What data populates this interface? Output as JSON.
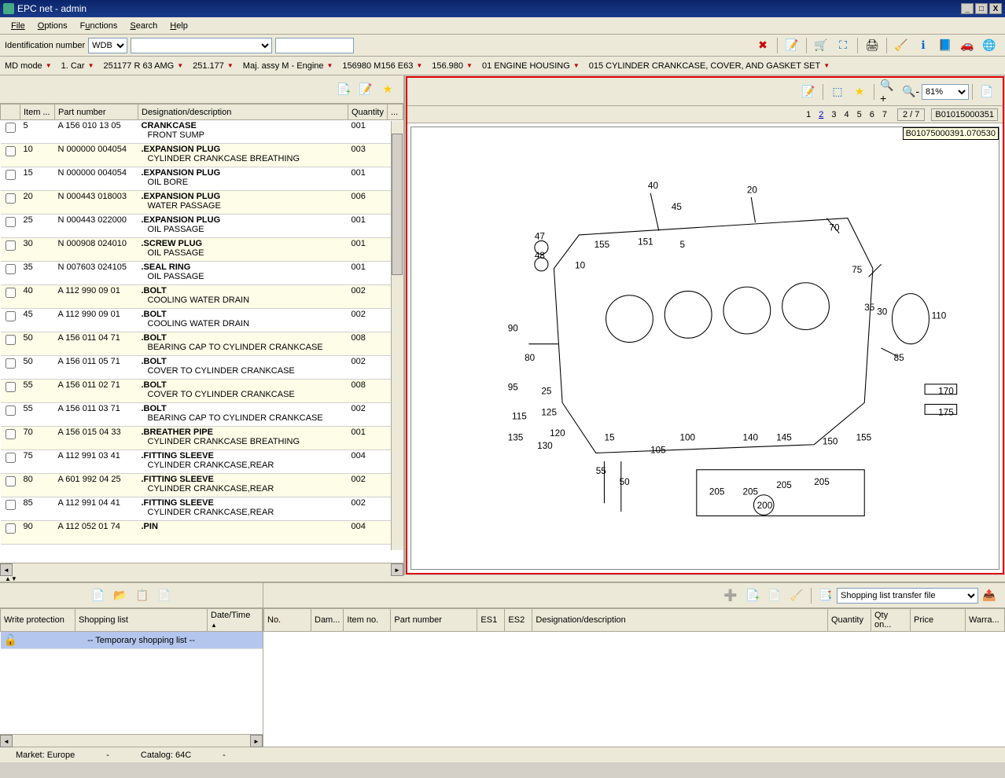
{
  "window": {
    "title": "EPC net - admin",
    "min": "_",
    "max": "□",
    "close": "X"
  },
  "menu": {
    "file": "File",
    "options": "Options",
    "functions": "Functions",
    "search": "Search",
    "help": "Help"
  },
  "idbar": {
    "label": "Identification number",
    "type_value": "WDB"
  },
  "breadcrumbs": [
    {
      "label": "MD mode"
    },
    {
      "label": "1. Car"
    },
    {
      "label": "251177 R 63 AMG"
    },
    {
      "label": "251.177"
    },
    {
      "label": "Maj. assy M  - Engine"
    },
    {
      "label": "156980 M156 E63"
    },
    {
      "label": "156.980"
    },
    {
      "label": "01 ENGINE HOUSING"
    },
    {
      "label": "015 CYLINDER CRANKCASE, COVER, AND GASKET SET"
    }
  ],
  "parts_table": {
    "headers": {
      "check": "",
      "item": "Item ...",
      "part": "Part number",
      "desig": "Designation/description",
      "qty": "Quantity",
      "more": "..."
    },
    "rows": [
      {
        "item": "5",
        "part": "A 156 010 13 05",
        "main": "CRANKCASE",
        "sub": "FRONT SUMP",
        "qty": "001"
      },
      {
        "item": "10",
        "part": "N 000000 004054",
        "main": ".EXPANSION PLUG",
        "sub": "CYLINDER CRANKCASE BREATHING",
        "qty": "003"
      },
      {
        "item": "15",
        "part": "N 000000 004054",
        "main": ".EXPANSION PLUG",
        "sub": "OIL BORE",
        "qty": "001"
      },
      {
        "item": "20",
        "part": "N 000443 018003",
        "main": ".EXPANSION PLUG",
        "sub": "WATER PASSAGE",
        "qty": "006"
      },
      {
        "item": "25",
        "part": "N 000443 022000",
        "main": ".EXPANSION PLUG",
        "sub": "OIL PASSAGE",
        "qty": "001"
      },
      {
        "item": "30",
        "part": "N 000908 024010",
        "main": ".SCREW PLUG",
        "sub": "OIL PASSAGE",
        "qty": "001"
      },
      {
        "item": "35",
        "part": "N 007603 024105",
        "main": ".SEAL RING",
        "sub": "OIL PASSAGE",
        "qty": "001"
      },
      {
        "item": "40",
        "part": "A 112 990 09 01",
        "main": ".BOLT",
        "sub": "COOLING WATER DRAIN",
        "qty": "002"
      },
      {
        "item": "45",
        "part": "A 112 990 09 01",
        "main": ".BOLT",
        "sub": "COOLING WATER DRAIN",
        "qty": "002"
      },
      {
        "item": "50",
        "part": "A 156 011 04 71",
        "main": ".BOLT",
        "sub": "BEARING CAP TO CYLINDER CRANKCASE",
        "qty": "008"
      },
      {
        "item": "50",
        "part": "A 156 011 05 71",
        "main": ".BOLT",
        "sub": "COVER TO CYLINDER CRANKCASE",
        "qty": "002"
      },
      {
        "item": "55",
        "part": "A 156 011 02 71",
        "main": ".BOLT",
        "sub": "COVER TO CYLINDER CRANKCASE",
        "qty": "008"
      },
      {
        "item": "55",
        "part": "A 156 011 03 71",
        "main": ".BOLT",
        "sub": "BEARING CAP TO CYLINDER CRANKCASE",
        "qty": "002"
      },
      {
        "item": "70",
        "part": "A 156 015 04 33",
        "main": ".BREATHER PIPE",
        "sub": "CYLINDER CRANKCASE BREATHING",
        "qty": "001"
      },
      {
        "item": "75",
        "part": "A 112 991 03 41",
        "main": ".FITTING SLEEVE",
        "sub": "CYLINDER CRANKCASE,REAR",
        "qty": "004"
      },
      {
        "item": "80",
        "part": "A 601 992 04 25",
        "main": ".FITTING SLEEVE",
        "sub": "CYLINDER CRANKCASE,REAR",
        "qty": "002"
      },
      {
        "item": "85",
        "part": "A 112 991 04 41",
        "main": ".FITTING SLEEVE",
        "sub": "CYLINDER CRANKCASE,REAR",
        "qty": "002"
      },
      {
        "item": "90",
        "part": "A 112 052 01 74",
        "main": ".PIN",
        "sub": "",
        "qty": "004"
      }
    ]
  },
  "diagram": {
    "zoom": "81%",
    "pages": [
      "1",
      "2",
      "3",
      "4",
      "5",
      "6",
      "7"
    ],
    "active_page": "2",
    "page_count": "2 / 7",
    "doc_id": "B01015000351",
    "tooltip": "B01075000391.070530",
    "callouts": [
      "40",
      "20",
      "47",
      "45",
      "48",
      "155",
      "151",
      "5",
      "70",
      "10",
      "75",
      "35",
      "30",
      "90",
      "110",
      "80",
      "85",
      "95",
      "25",
      "170",
      "115",
      "125",
      "175",
      "135",
      "120",
      "15",
      "100",
      "140",
      "145",
      "150",
      "155",
      "130",
      "105",
      "55",
      "50",
      "205",
      "205",
      "205",
      "205",
      "200"
    ]
  },
  "shopping_left": {
    "headers": {
      "wp": "Write protection",
      "list": "Shopping list",
      "dt": "Date/Time"
    },
    "row": {
      "list": "-- Temporary shopping list --"
    }
  },
  "shopping_right": {
    "transfer_label": "Shopping list transfer file",
    "headers": {
      "no": "No.",
      "dam": "Dam...",
      "item": "Item no.",
      "part": "Part number",
      "es1": "ES1",
      "es2": "ES2",
      "desig": "Designation/description",
      "qty": "Quantity",
      "qtyon": "Qty on...",
      "price": "Price",
      "warra": "Warra..."
    }
  },
  "status": {
    "market_label": "Market:",
    "market_value": "Europe",
    "catalog_label": "Catalog:",
    "catalog_value": "64C",
    "dash": "-"
  }
}
